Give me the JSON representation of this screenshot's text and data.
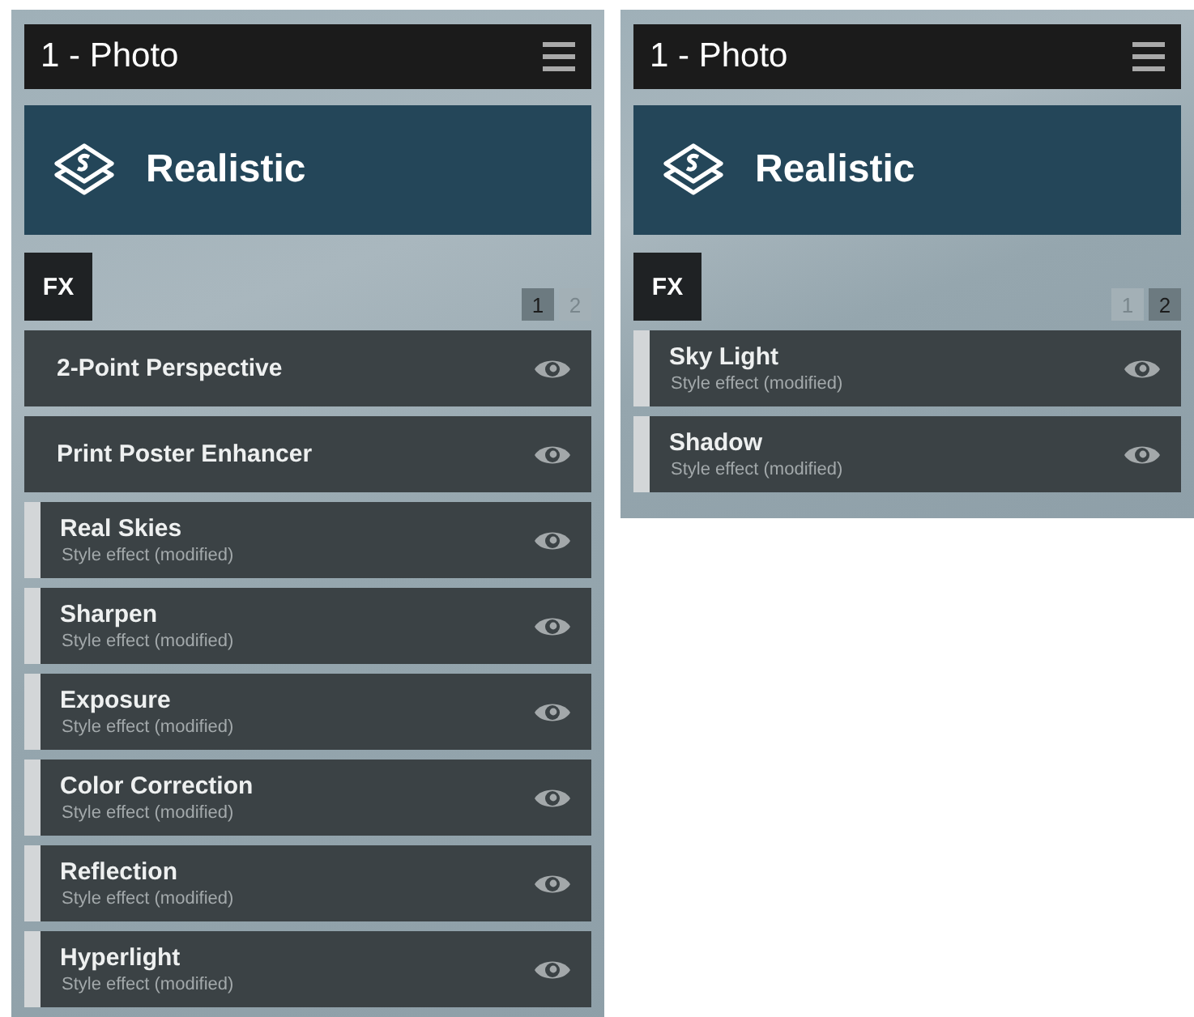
{
  "panels": [
    {
      "title": "1 - Photo",
      "style_name": "Realistic",
      "fx_label": "FX",
      "pages": [
        {
          "label": "1",
          "selected": true
        },
        {
          "label": "2",
          "selected": false
        }
      ],
      "items": [
        {
          "kind": "effect",
          "name": "2-Point Perspective"
        },
        {
          "kind": "effect",
          "name": "Print Poster Enhancer"
        },
        {
          "kind": "style",
          "name": "Real Skies",
          "subtitle": "Style effect (modified)"
        },
        {
          "kind": "style",
          "name": "Sharpen",
          "subtitle": "Style effect (modified)"
        },
        {
          "kind": "style",
          "name": "Exposure",
          "subtitle": "Style effect (modified)"
        },
        {
          "kind": "style",
          "name": "Color Correction",
          "subtitle": "Style effect (modified)"
        },
        {
          "kind": "style",
          "name": "Reflection",
          "subtitle": "Style effect (modified)"
        },
        {
          "kind": "style",
          "name": "Hyperlight",
          "subtitle": "Style effect (modified)"
        }
      ]
    },
    {
      "title": "1 - Photo",
      "style_name": "Realistic",
      "fx_label": "FX",
      "pages": [
        {
          "label": "1",
          "selected": false
        },
        {
          "label": "2",
          "selected": true
        }
      ],
      "items": [
        {
          "kind": "style",
          "name": "Sky Light",
          "subtitle": "Style effect (modified)"
        },
        {
          "kind": "style",
          "name": "Shadow",
          "subtitle": "Style effect (modified)"
        }
      ]
    }
  ]
}
